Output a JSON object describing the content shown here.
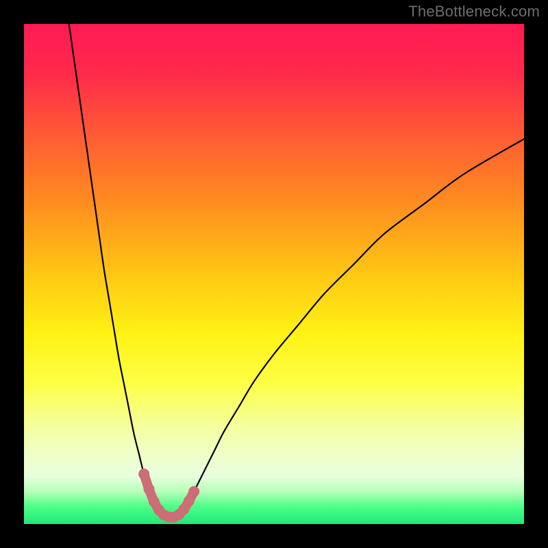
{
  "watermark": "TheBottleneck.com",
  "gradient": {
    "stops": [
      {
        "offset": 0.0,
        "color": "#ff1a55"
      },
      {
        "offset": 0.1,
        "color": "#ff2a4a"
      },
      {
        "offset": 0.22,
        "color": "#ff5a35"
      },
      {
        "offset": 0.35,
        "color": "#ff8a20"
      },
      {
        "offset": 0.5,
        "color": "#ffc714"
      },
      {
        "offset": 0.62,
        "color": "#fff214"
      },
      {
        "offset": 0.72,
        "color": "#fdff46"
      },
      {
        "offset": 0.8,
        "color": "#f5ff9a"
      },
      {
        "offset": 0.86,
        "color": "#efffc8"
      },
      {
        "offset": 0.905,
        "color": "#e6ffde"
      },
      {
        "offset": 0.935,
        "color": "#b8ffb8"
      },
      {
        "offset": 0.965,
        "color": "#4dff88"
      },
      {
        "offset": 1.0,
        "color": "#20e878"
      }
    ]
  },
  "chart_data": {
    "type": "line",
    "title": "",
    "xlabel": "",
    "ylabel": "",
    "xlim": [
      0,
      100
    ],
    "ylim": [
      0,
      100
    ],
    "series": [
      {
        "name": "bottleneck-curve",
        "x": [
          9,
          10,
          11,
          12,
          13,
          14,
          15,
          16,
          17,
          18,
          19,
          20,
          21,
          22,
          23,
          24,
          25,
          26,
          27,
          28,
          29,
          30,
          31,
          32,
          33,
          34,
          36,
          38,
          40,
          43,
          46,
          50,
          55,
          60,
          66,
          72,
          80,
          88,
          100
        ],
        "y": [
          100,
          93,
          86,
          79,
          72,
          65,
          58,
          51,
          45,
          39,
          33,
          28,
          23,
          18,
          14,
          10,
          7,
          4.5,
          2.8,
          1.8,
          1.4,
          1.4,
          1.9,
          3.0,
          4.6,
          6.5,
          10.5,
          14.5,
          18.5,
          23.5,
          28.5,
          34,
          40,
          46,
          52,
          58,
          64,
          70,
          77
        ]
      }
    ],
    "highlight": {
      "name": "optimal-range",
      "color": "#cd6d76",
      "x": [
        24,
        25,
        26,
        27,
        28,
        29,
        30,
        31,
        32,
        33,
        34
      ],
      "y": [
        10,
        7,
        4.5,
        2.8,
        1.8,
        1.4,
        1.4,
        1.9,
        3.0,
        4.6,
        6.5
      ]
    }
  }
}
